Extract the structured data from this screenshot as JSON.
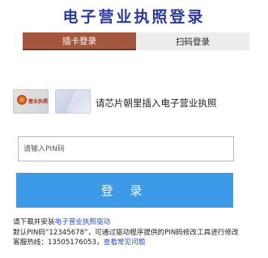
{
  "title": "电子营业执照登录",
  "tabs": [
    {
      "label": "插卡登录",
      "active": true
    },
    {
      "label": "扫码登录",
      "active": false
    }
  ],
  "cards": {
    "license_stamp": "营业执照"
  },
  "insert_prompt": "请芯片朝里插入电子营业执照",
  "pin": {
    "placeholder": "请输入PIN码",
    "value": ""
  },
  "login_button": "登 录",
  "notes": {
    "line1_prefix": "请下载并安装",
    "driver_link": "电子营业执照驱动",
    "line2": "默认PIN码“12345678”，可通过驱动程序提供的PIN码修改工具进行修改",
    "line3_prefix": "客服热线：13505176053，",
    "faq_link": "查看常见问题"
  },
  "colors": {
    "title": "#2d3a9c",
    "active_tab": "#a4573f",
    "inactive_tab": "#ededed",
    "login_button": "#3d9ae8",
    "link": "#2a4bd0"
  }
}
